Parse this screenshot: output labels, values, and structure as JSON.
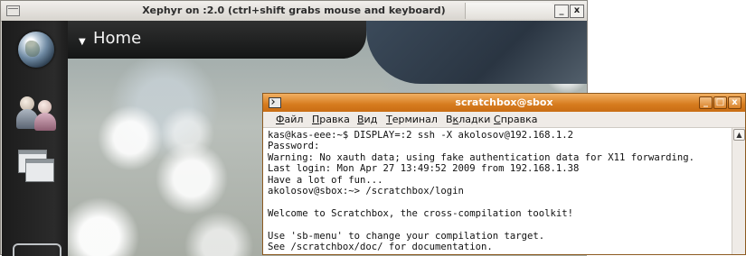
{
  "xephyr": {
    "title": "Xephyr on :2.0 (ctrl+shift grabs mouse and keyboard)",
    "min_glyph": "_",
    "close_glyph": "x"
  },
  "desktop": {
    "home_arrow": "▼",
    "home_title": "Home"
  },
  "terminal": {
    "title": "scratchbox@sbox",
    "buttons": {
      "min": "_",
      "max": "□",
      "close": "x"
    },
    "menu": [
      {
        "accel": "Ф",
        "rest": "айл"
      },
      {
        "accel": "П",
        "rest": "равка"
      },
      {
        "accel": "В",
        "rest": "ид"
      },
      {
        "accel": "Т",
        "rest": "ерминал"
      },
      {
        "pre": "В",
        "accel": "к",
        "rest": "ладки"
      },
      {
        "accel": "С",
        "rest": "правка"
      }
    ],
    "lines": [
      "kas@kas-eee:~$ DISPLAY=:2 ssh -X akolosov@192.168.1.2",
      "Password:",
      "Warning: No xauth data; using fake authentication data for X11 forwarding.",
      "Last login: Mon Apr 27 13:49:52 2009 from 192.168.1.38",
      "Have a lot of fun...",
      "akolosov@sbox:~> /scratchbox/login",
      "",
      "Welcome to Scratchbox, the cross-compilation toolkit!",
      "",
      "Use 'sb-menu' to change your compilation target.",
      "See /scratchbox/doc/ for documentation."
    ],
    "scroll_up": "▲"
  }
}
